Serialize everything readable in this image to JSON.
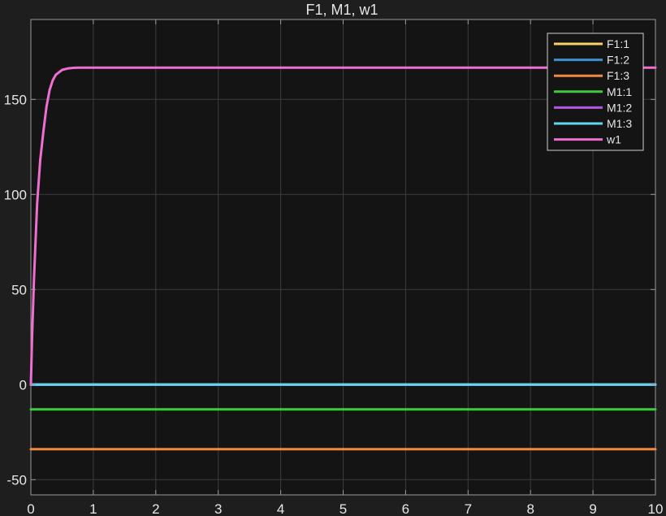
{
  "chart_data": {
    "type": "line",
    "title": "F1, M1, w1",
    "xlabel": "",
    "ylabel": "",
    "xlim": [
      0,
      10
    ],
    "ylim": [
      -58,
      192
    ],
    "x_ticks": [
      0,
      1,
      2,
      3,
      4,
      5,
      6,
      7,
      8,
      9,
      10
    ],
    "y_ticks": [
      -50,
      0,
      50,
      100,
      150
    ],
    "grid": true,
    "legend_position": "top-right",
    "background_color": "#141414",
    "axes_color": "#9a9a9a",
    "series": [
      {
        "name": "F1:1",
        "color": "#f5d36b",
        "x": [
          0,
          10
        ],
        "y": [
          0,
          0
        ]
      },
      {
        "name": "F1:2",
        "color": "#3d8fd6",
        "x": [
          0,
          10
        ],
        "y": [
          0,
          0
        ]
      },
      {
        "name": "F1:3",
        "color": "#f08a3c",
        "x": [
          0,
          10
        ],
        "y": [
          -34,
          -34
        ]
      },
      {
        "name": "M1:1",
        "color": "#3ec93e",
        "x": [
          0,
          10
        ],
        "y": [
          -13,
          -13
        ]
      },
      {
        "name": "M1:2",
        "color": "#b45ae0",
        "x": [
          0,
          10
        ],
        "y": [
          0,
          0
        ]
      },
      {
        "name": "M1:3",
        "color": "#5fd8f0",
        "x": [
          0,
          10
        ],
        "y": [
          0,
          0
        ]
      },
      {
        "name": "w1",
        "color": "#ee6fcf",
        "x": [
          0,
          0.02,
          0.05,
          0.1,
          0.15,
          0.2,
          0.25,
          0.3,
          0.35,
          0.4,
          0.5,
          0.6,
          0.7,
          0.8,
          1.0,
          1.5,
          2,
          3,
          4,
          5,
          6,
          7,
          8,
          9,
          10
        ],
        "y": [
          0,
          25,
          55,
          95,
          118,
          133,
          146,
          155,
          160,
          163,
          165.5,
          166.3,
          166.6,
          166.7,
          166.7,
          166.7,
          166.7,
          166.7,
          166.7,
          166.7,
          166.7,
          166.7,
          166.7,
          166.7,
          166.7
        ]
      }
    ]
  }
}
